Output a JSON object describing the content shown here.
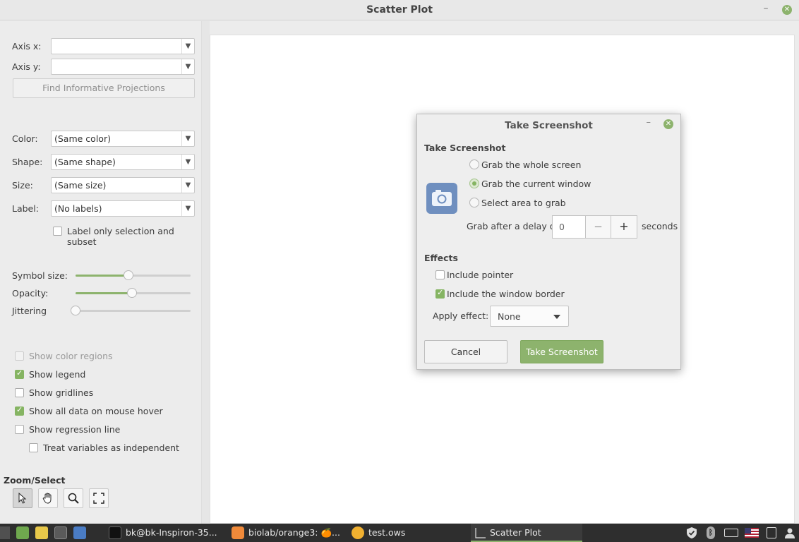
{
  "window": {
    "title": "Scatter Plot"
  },
  "left_panel": {
    "axis_x_label": "Axis x:",
    "axis_x_value": "",
    "axis_y_label": "Axis y:",
    "axis_y_value": "",
    "find_projections_label": "Find Informative Projections",
    "color_label": "Color:",
    "color_value": "(Same color)",
    "shape_label": "Shape:",
    "shape_value": "(Same shape)",
    "size_label": "Size:",
    "size_value": "(Same size)",
    "label_label": "Label:",
    "label_value": "(No labels)",
    "label_only_selection": "Label only selection and subset",
    "label_only_selection_checked": false,
    "symbol_size_label": "Symbol size:",
    "symbol_size_level": 0.46,
    "opacity_label": "Opacity:",
    "opacity_level": 0.49,
    "jittering_label": "Jittering",
    "jittering_level": 0,
    "show_color_regions": "Show color regions",
    "show_color_regions_checked": false,
    "show_legend": "Show legend",
    "show_legend_checked": true,
    "show_gridlines": "Show gridlines",
    "show_gridlines_checked": false,
    "show_all_data": "Show all data on mouse hover",
    "show_all_data_checked": true,
    "show_regression": "Show regression line",
    "show_regression_checked": false,
    "treat_independent": "Treat variables as independent",
    "treat_independent_checked": false,
    "zoom_select_title": "Zoom/Select"
  },
  "dialog": {
    "title": "Take Screenshot",
    "section_take": "Take Screenshot",
    "option_whole_screen": "Grab the whole screen",
    "option_current_window": "Grab the current window",
    "option_select_area": "Select area to grab",
    "selected_option": "Grab the current window",
    "delay_label": "Grab after a delay of",
    "delay_value": "0",
    "delay_unit": "seconds",
    "section_effects": "Effects",
    "include_pointer": "Include pointer",
    "include_pointer_checked": false,
    "include_border": "Include the window border",
    "include_border_checked": true,
    "apply_effect_label": "Apply effect:",
    "apply_effect_value": "None",
    "cancel_label": "Cancel",
    "take_label": "Take Screenshot"
  },
  "taskbar": {
    "items": [
      {
        "label": "bk@bk-Inspiron-35..."
      },
      {
        "label": "biolab/orange3: 🍊..."
      },
      {
        "label": "test.ows"
      },
      {
        "label": "Scatter Plot"
      }
    ],
    "active_item": "Scatter Plot"
  },
  "colors": {
    "accent": "#8db36d",
    "taskbar": "#2e2e2e",
    "camera": "#6f8fbf"
  }
}
